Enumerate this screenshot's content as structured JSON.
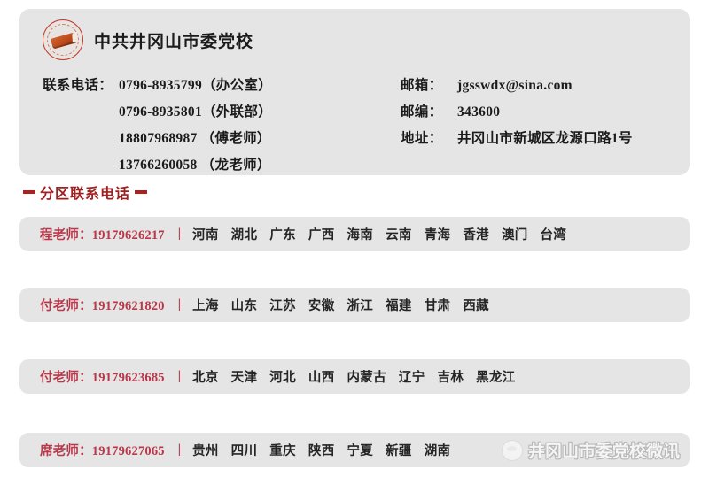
{
  "org": {
    "seal_icon": "school-seal-icon",
    "title": "中共井冈山市委党校"
  },
  "contact": {
    "phone_label": "联系电话：",
    "phones": [
      "0796-8935799（办公室）",
      "0796-8935801（外联部）",
      "18807968987 （傅老师）",
      "13766260058 （龙老师）"
    ],
    "email_label": "邮箱：",
    "email": "jgsswdx@sina.com",
    "postcode_label": "邮编：",
    "postcode": "343600",
    "address_label": "地址：",
    "address": "井冈山市新城区龙源口路1号"
  },
  "section": {
    "heading": "分区联系电话",
    "dash_color": "#b01f1f",
    "heading_color": "#9f2020"
  },
  "regions": [
    {
      "teacher": "程老师：19179626217",
      "separator": "|",
      "provinces": [
        "河南",
        "湖北",
        "广东",
        "广西",
        "海南",
        "云南",
        "青海",
        "香港",
        "澳门",
        "台湾"
      ]
    },
    {
      "teacher": "付老师：19179621820",
      "separator": "|",
      "provinces": [
        "上海",
        "山东",
        "江苏",
        "安徽",
        "浙江",
        "福建",
        "甘肃",
        "西藏"
      ]
    },
    {
      "teacher": "付老师：19179623685",
      "separator": "|",
      "provinces": [
        "北京",
        "天津",
        "河北",
        "山西",
        "内蒙古",
        "辽宁",
        "吉林",
        "黑龙江"
      ]
    },
    {
      "teacher": "席老师：19179627065",
      "separator": "|",
      "provinces": [
        "贵州",
        "四川",
        "重庆",
        "陕西",
        "宁夏",
        "新疆",
        "湖南"
      ]
    }
  ],
  "watermark": {
    "logo_icon": "wechat-account-logo-icon",
    "text": "井冈山市委党校微讯"
  },
  "colors": {
    "card_bg": "#e5e5e5",
    "page_bg": "#ffffff",
    "accent_red": "#b8384a",
    "heading_red": "#9f2020",
    "text_dark": "#1b1b1b"
  }
}
